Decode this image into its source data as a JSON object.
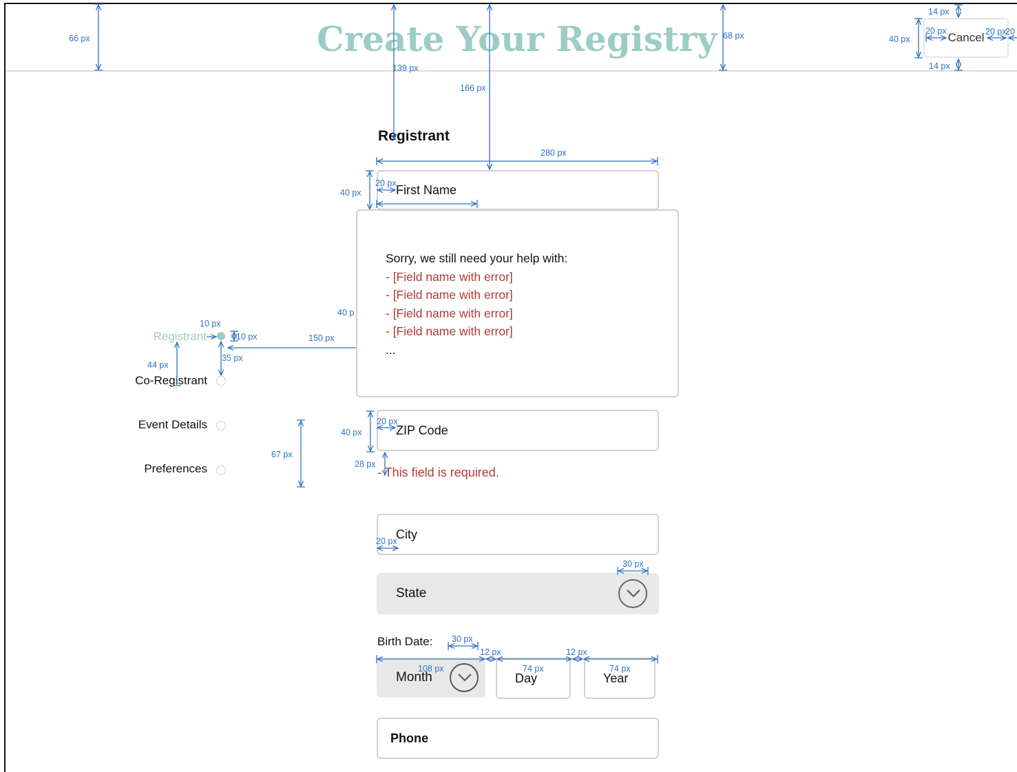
{
  "header": {
    "title": "Create Your Registry",
    "cancel_label": "Cancel"
  },
  "form": {
    "section_heading": "Registrant",
    "first_name_label": "First Name",
    "zip_label": "ZIP Code",
    "zip_error": "- This field is required.",
    "city_label": "City",
    "state_label": "State",
    "birth_date_label": "Birth Date:",
    "month_label": "Month",
    "day_label": "Day",
    "year_label": "Year",
    "phone_label": "Phone"
  },
  "error_popup": {
    "intro": "Sorry, we still need your help with:",
    "errors": [
      "- [Field name with error]",
      "- [Field name with error]",
      "- [Field name with error]",
      "- [Field name with error]"
    ],
    "ellipsis": "..."
  },
  "steps": [
    {
      "label": "Registrant",
      "active": true
    },
    {
      "label": "Co-Registrant",
      "active": false
    },
    {
      "label": "Event Details",
      "active": false
    },
    {
      "label": "Preferences",
      "active": false
    }
  ],
  "annotations": {
    "header_height": "66 px",
    "title_gap": "139 px",
    "heading_gap": "166 px",
    "title_height": "68 px",
    "cancel_height": "40 px",
    "cancel_top": "14 px",
    "cancel_bottom": "14 px",
    "cancel_pad_left": "20 px",
    "cancel_pad_right": "20 px",
    "cancel_edge": "20",
    "field_width": "280 px",
    "field_height_first": "40 px",
    "field_pad_first": "20 px",
    "label_width": "100",
    "modal_height": "40 p",
    "dot_size_w": "10 px",
    "dot_size_h": "10 px",
    "dot_gap": "150 px",
    "dot_spacing": "35 px",
    "step_spacing": "44 px",
    "steps_height": "67 px",
    "zip_height": "40 px",
    "zip_pad": "20 px",
    "error_gap": "28 px",
    "city_pad": "20 px",
    "chevron_size": "30 px",
    "month_chevron": "30 px",
    "gap_1": "12 px",
    "gap_2": "12 px",
    "month_width": "108 px",
    "day_width": "74 px",
    "year_width": "74 px"
  },
  "colors": {
    "title": "#9ccdc4",
    "error": "#b03a3a",
    "annotation": "#2e72c4",
    "active_step": "#9ccdc4"
  },
  "icons": {
    "state_chevron": "chevron-down-circle-icon",
    "month_chevron": "chevron-down-circle-icon"
  }
}
